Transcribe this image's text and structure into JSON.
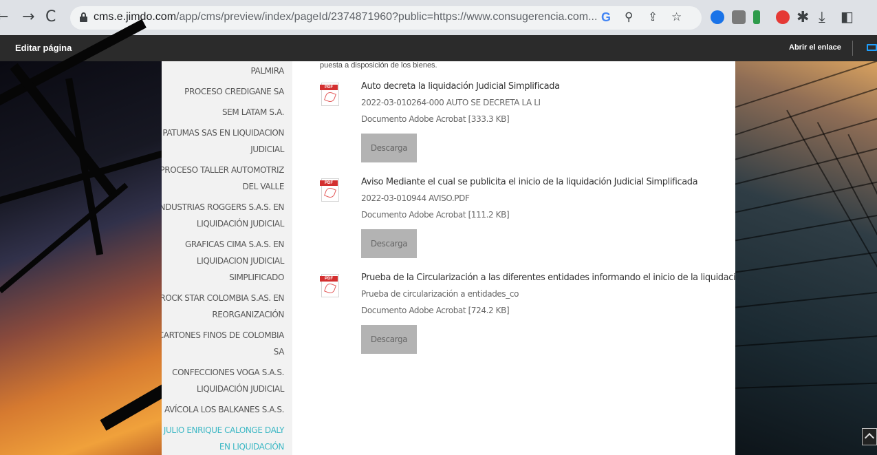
{
  "browser": {
    "url_host": "cms.e.jimdo.com",
    "url_path": "/app/cms/preview/index/pageId/2374871960?public=https://www.consugerencia.com..."
  },
  "editor": {
    "edit_label": "Editar página",
    "open_link_label": "Abrir el enlace"
  },
  "sidebar": {
    "items": [
      "PALMIRA",
      "PROCESO CREDIGANE SA",
      "SEM LATAM S.A.",
      "PATUMAS SAS EN LIQUIDACION JUDICIAL",
      "PROCESO TALLER AUTOMOTRIZ DEL VALLE",
      "INDUSTRIAS ROGGERS S.A.S. EN LIQUIDACIÓN JUDICIAL",
      "GRAFICAS CIMA S.A.S. EN LIQUIDACION JUDICIAL SIMPLIFICADO",
      "ROCK STAR COLOMBIA S.AS. EN REORGANIZACIÓN",
      "CARTONES FINOS DE COLOMBIA SA",
      "CONFECCIONES VOGA S.A.S. LIQUIDACIÓN JUDICIAL",
      "AVÍCOLA LOS BALKANES S.A.S.",
      "JULIO ENRIQUE CALONGE DALY EN LIQUIDACIÓN"
    ],
    "active_index": 11
  },
  "main": {
    "intro": "puesta a disposición de los bienes.",
    "documents": [
      {
        "title": "Auto decreta la liquidación Judicial Simplificada",
        "file": "2022-03-010264-000 AUTO SE DECRETA LA LI",
        "meta": "Documento Adobe Acrobat [333.3 KB]",
        "button": "Descarga"
      },
      {
        "title": "Aviso Mediante el cual se publicita el inicio de la liquidación Judicial Simplificada",
        "file": "2022-03-010944 AVISO.PDF",
        "meta": "Documento Adobe Acrobat [111.2 KB]",
        "button": "Descarga"
      },
      {
        "title": "Prueba de la Circularización a las diferentes entidades informando el inicio de la liquidación Judicial",
        "file": "Prueba de circularización a entidades_co",
        "meta": "Documento Adobe Acrobat [724.2 KB]",
        "button": "Descarga"
      }
    ]
  },
  "icons": {
    "back": "arrow-left-icon",
    "forward": "arrow-right-icon",
    "reload": "reload-icon",
    "pdf_tag": "PDF"
  },
  "colors": {
    "active_nav": "#3bb7c4",
    "button_bg": "#b3b3b3"
  }
}
